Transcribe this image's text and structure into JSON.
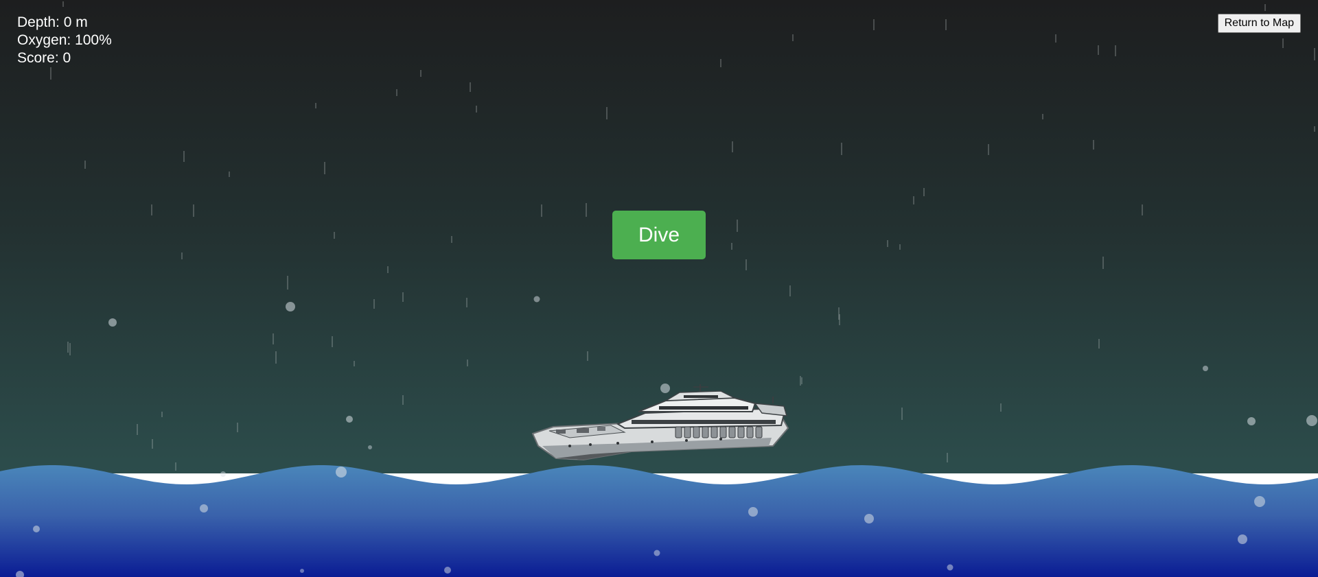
{
  "hud": {
    "depth_label": "Depth: 0 m",
    "oxygen_label": "Oxygen: 100%",
    "score_label": "Score: 0"
  },
  "controls": {
    "return_label": "Return to Map",
    "dive_label": "Dive"
  },
  "game_state": {
    "depth_m": 0,
    "oxygen_pct": 100,
    "score": 0
  },
  "colors": {
    "sky_top": "#1d1e1f",
    "sky_bottom": "#2e5451",
    "water_top": "#4a86ba",
    "water_bottom": "#0a1c94",
    "dive_button": "#4caf50",
    "foam": "#ffffff"
  },
  "icons": {
    "ship": "ship-icon"
  }
}
